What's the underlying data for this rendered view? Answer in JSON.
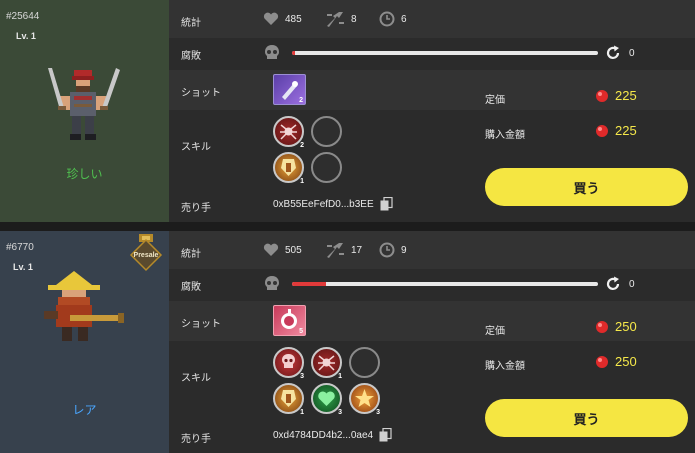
{
  "labels": {
    "stats": "統計",
    "decay": "腐敗",
    "shot": "ショット",
    "skill": "スキル",
    "seller": "売り手",
    "list_price": "定価",
    "purchase_price": "購入金額",
    "buy": "買う"
  },
  "colors": {
    "buy_button": "#f5e642",
    "price_text": "#f5e84a",
    "rarity_rare_green": "#4fc04f",
    "rarity_rare_blue": "#4aa6ff",
    "decay_fill": "#e13a3a"
  },
  "listings": [
    {
      "id": "#25644",
      "level": "Lv. 1",
      "rarity": "珍しい",
      "rarity_color": "#4fc04f",
      "presale": "",
      "stats": {
        "hearts": "485",
        "attacks": "8",
        "time": "6"
      },
      "decay": {
        "level": 0.01,
        "count": "0"
      },
      "shot_count": "2",
      "skills": [
        {
          "icon": "spider-icon",
          "count": "2"
        },
        {
          "icon": "empty",
          "count": ""
        },
        {
          "icon": "shield-guard-icon",
          "count": "1"
        },
        {
          "icon": "empty",
          "count": ""
        }
      ],
      "list_price": "225",
      "purchase_price": "225",
      "seller": "0xB55EeFefD0...b3EE"
    },
    {
      "id": "#6770",
      "level": "Lv. 1",
      "rarity": "レア",
      "rarity_color": "#4aa6ff",
      "presale": "Presale",
      "stats": {
        "hearts": "505",
        "attacks": "17",
        "time": "9"
      },
      "decay": {
        "level": 0.11,
        "count": "0"
      },
      "shot_count": "5",
      "skills": [
        {
          "icon": "skull-icon",
          "count": "3"
        },
        {
          "icon": "spider-icon",
          "count": "1"
        },
        {
          "icon": "empty",
          "count": ""
        },
        {
          "icon": "shield-guard-icon",
          "count": "1"
        },
        {
          "icon": "heart-heal-icon",
          "count": "3"
        },
        {
          "icon": "burst-icon",
          "count": "3"
        }
      ],
      "list_price": "250",
      "purchase_price": "250",
      "seller": "0xd4784DD4b2...0ae4"
    }
  ]
}
